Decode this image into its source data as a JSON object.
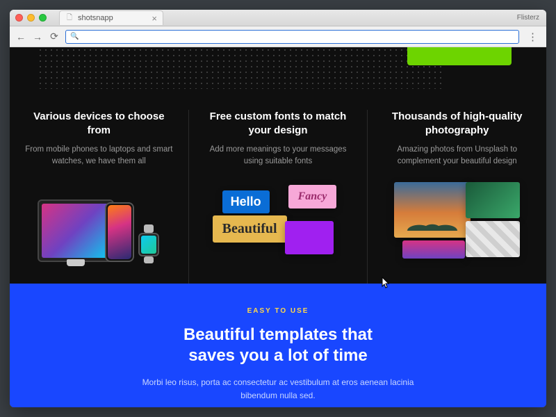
{
  "browser": {
    "tab_title": "shotsnapp",
    "right_label": "Flisterz"
  },
  "features": [
    {
      "title": "Various devices to choose from",
      "desc": "From mobile phones to laptops and smart watches, we have them all"
    },
    {
      "title": "Free custom fonts to match your design",
      "desc": "Add more meanings to your messages using suitable fonts",
      "cards": {
        "hello": "Hello",
        "fancy": "Fancy",
        "beautiful": "Beautiful"
      }
    },
    {
      "title": "Thousands of high-quality photography",
      "desc": "Amazing photos from Unsplash to complement your beautiful design"
    }
  ],
  "blue": {
    "eyebrow": "EASY TO USE",
    "heading_l1": "Beautiful templates that",
    "heading_l2": "saves you a lot of time",
    "body": "Morbi leo risus, porta ac consectetur ac vestibulum at eros aenean lacinia bibendum nulla sed."
  }
}
